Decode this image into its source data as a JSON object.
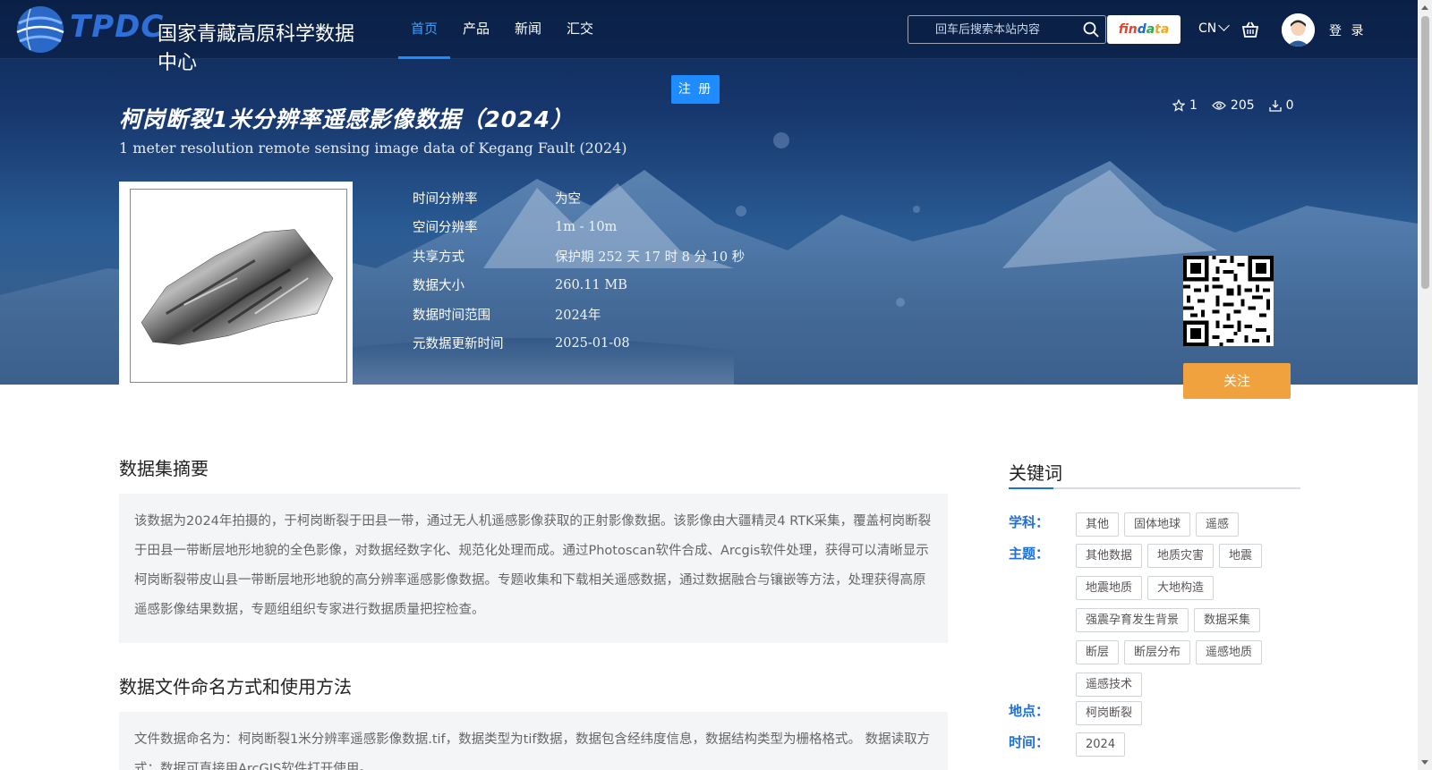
{
  "nav": {
    "logo_mark": "TPDC",
    "logo_name": "国家青藏高原科学数据中心",
    "links": [
      "首页",
      "产品",
      "新闻",
      "汇交"
    ],
    "active_index": 0,
    "search_placeholder": "回车后搜索本站内容",
    "findata": [
      "fin",
      "d",
      "a",
      "ta"
    ],
    "lang": "CN",
    "login": "登 录"
  },
  "register_label": "注 册",
  "dataset": {
    "title_cn": "柯岗断裂1米分辨率遥感影像数据（2024）",
    "title_en": "1 meter resolution remote sensing image data of Kegang Fault (2024)",
    "stats": {
      "stars": "1",
      "views": "205",
      "downloads": "0"
    },
    "meta": [
      {
        "label": "时间分辨率",
        "value": "为空"
      },
      {
        "label": "空间分辨率",
        "value": "1m - 10m"
      },
      {
        "label": "共享方式",
        "value": "保护期 252 天 17 时 8 分 10 秒"
      },
      {
        "label": "数据大小",
        "value": "260.11 MB"
      },
      {
        "label": "数据时间范围",
        "value": "2024年"
      },
      {
        "label": "元数据更新时间",
        "value": "2025-01-08"
      }
    ],
    "follow_label": "关注"
  },
  "abstract": {
    "title": "数据集摘要",
    "text": "该数据为2024年拍摄的，于柯岗断裂于田县一带，通过无人机遥感影像获取的正射影像数据。该影像由大疆精灵4 RTK采集，覆盖柯岗断裂于田县一带断层地形地貌的全色影像，对数据经数字化、规范化处理而成。通过Photoscan软件合成、Arcgis软件处理，获得可以清晰显示柯岗断裂带皮山县一带断层地形地貌的高分辨率遥感影像数据。专题收集和下载相关遥感数据，通过数据融合与镶嵌等方法，处理获得高原遥感影像结果数据，专题组组织专家进行数据质量把控检查。"
  },
  "naming": {
    "title": "数据文件命名方式和使用方法",
    "text": "文件数据命名为：柯岗断裂1米分辨率遥感影像数据.tif，数据类型为tif数据，数据包含经纬度信息，数据结构类型为栅格格式。 数据读取方式：数据可直接用ArcGIS软件打开使用。"
  },
  "keywords": {
    "title": "关键词",
    "groups": [
      {
        "label": "学科：",
        "tags": [
          "其他",
          "固体地球",
          "遥感"
        ]
      },
      {
        "label": "主题：",
        "tags": [
          "其他数据",
          "地质灾害",
          "地震",
          "地震地质",
          "大地构造",
          "强震孕育发生背景",
          "数据采集",
          "断层",
          "断层分布",
          "遥感地质",
          "遥感技术"
        ]
      },
      {
        "label": "地点：",
        "tags": [
          "柯岗断裂"
        ]
      },
      {
        "label": "时间：",
        "tags": [
          "2024"
        ]
      }
    ]
  }
}
